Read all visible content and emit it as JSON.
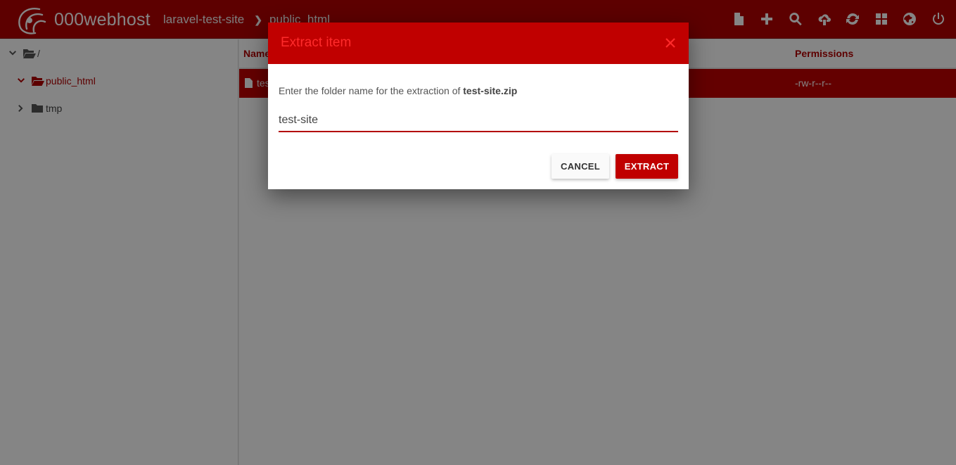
{
  "app": {
    "brand": "000webhost"
  },
  "breadcrumb": {
    "items": [
      "laravel-test-site",
      "public_html"
    ]
  },
  "toolbar": {
    "icons": [
      "new-file-icon",
      "plus-icon",
      "search-icon",
      "upload-icon",
      "refresh-icon",
      "grid-icon",
      "globe-icon",
      "power-icon"
    ]
  },
  "sidebar": {
    "root_label": "/",
    "items": [
      {
        "label": "public_html",
        "active": true
      },
      {
        "label": "tmp",
        "active": false
      }
    ]
  },
  "table": {
    "headers": {
      "name": "Name",
      "permissions": "Permissions"
    },
    "rows": [
      {
        "name": "test-site.zip",
        "name_visible": "tes",
        "permissions": "-rw-r--r--"
      }
    ]
  },
  "dialog": {
    "title": "Extract item",
    "message": "Enter the folder name for the extraction of ",
    "filename": "test-site.zip",
    "input_value": "test-site",
    "cancel_label": "CANCEL",
    "extract_label": "EXTRACT"
  },
  "colors": {
    "accent": "#b30000",
    "accent_light": "#ff2b2b",
    "selected_row": "#c00000"
  }
}
